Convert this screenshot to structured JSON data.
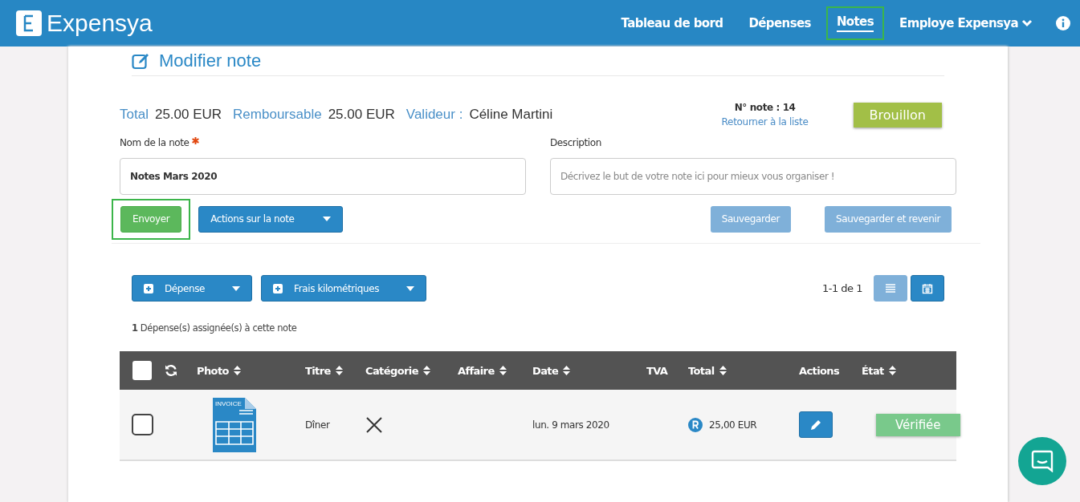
{
  "app": {
    "brand": "Expensya"
  },
  "nav": [
    {
      "label": "Tableau de bord",
      "selected": false,
      "highlighted": false
    },
    {
      "label": "Dépenses",
      "selected": false,
      "highlighted": false
    },
    {
      "label": "Notes",
      "selected": true,
      "highlighted": true
    },
    {
      "label": "Employe Expensya",
      "selected": false,
      "highlighted": false
    }
  ],
  "page_title": "Modifier note",
  "summary": [
    {
      "label": "Total",
      "value": "25.00 EUR"
    },
    {
      "label": "Remboursable",
      "value": "25.00 EUR"
    },
    {
      "label": "Valideur :",
      "value": "Céline Martini"
    }
  ],
  "note_number": "N° note : 14",
  "back_link": "Retourner à la liste",
  "status_badge": "Brouillon",
  "name_field": {
    "label": "Nom de la note",
    "required": true,
    "value": "Notes Mars 2020"
  },
  "description_field": {
    "label": "Description",
    "placeholder": "Décrivez le but de votre note ici pour mieux vous organiser !"
  },
  "actions": [
    {
      "label": "Envoyer",
      "kind": "success",
      "highlighted": true
    },
    {
      "label": "Actions sur la note",
      "kind": "dropdown",
      "highlighted": false
    },
    {
      "label": "Sauvegarder",
      "kind": "muted",
      "highlighted": false
    },
    {
      "label": "Sauvegarder et revenir",
      "kind": "muted",
      "highlighted": false
    }
  ],
  "add_buttons": [
    {
      "label": "Dépense"
    },
    {
      "label": "Frais kilométriques"
    }
  ],
  "pagination": "1-1 de 1",
  "view_toggle": [
    {
      "kind": "list",
      "selected": true
    },
    {
      "kind": "calendar",
      "selected": false
    }
  ],
  "assigned_count": {
    "count": "1",
    "text": "Dépense(s) assignée(s) à cette note"
  },
  "table": {
    "select_all": {
      "checked": false
    },
    "columns": [
      {
        "label": "Photo",
        "sortable": true
      },
      {
        "label": "Titre",
        "sortable": true
      },
      {
        "label": "Catégorie",
        "sortable": true
      },
      {
        "label": "Affaire",
        "sortable": true
      },
      {
        "label": "Date",
        "sortable": true
      },
      {
        "label": "TVA",
        "sortable": false
      },
      {
        "label": "Total",
        "sortable": true
      },
      {
        "label": "Actions",
        "sortable": false
      },
      {
        "label": "État",
        "sortable": true
      }
    ],
    "rows": [
      {
        "checked": false,
        "photo_label": "INVOICE",
        "title": "Dîner",
        "date": "lun. 9 mars 2020",
        "total": "25,00 EUR",
        "reimbursable": true,
        "status": "Vérifiée"
      }
    ]
  }
}
